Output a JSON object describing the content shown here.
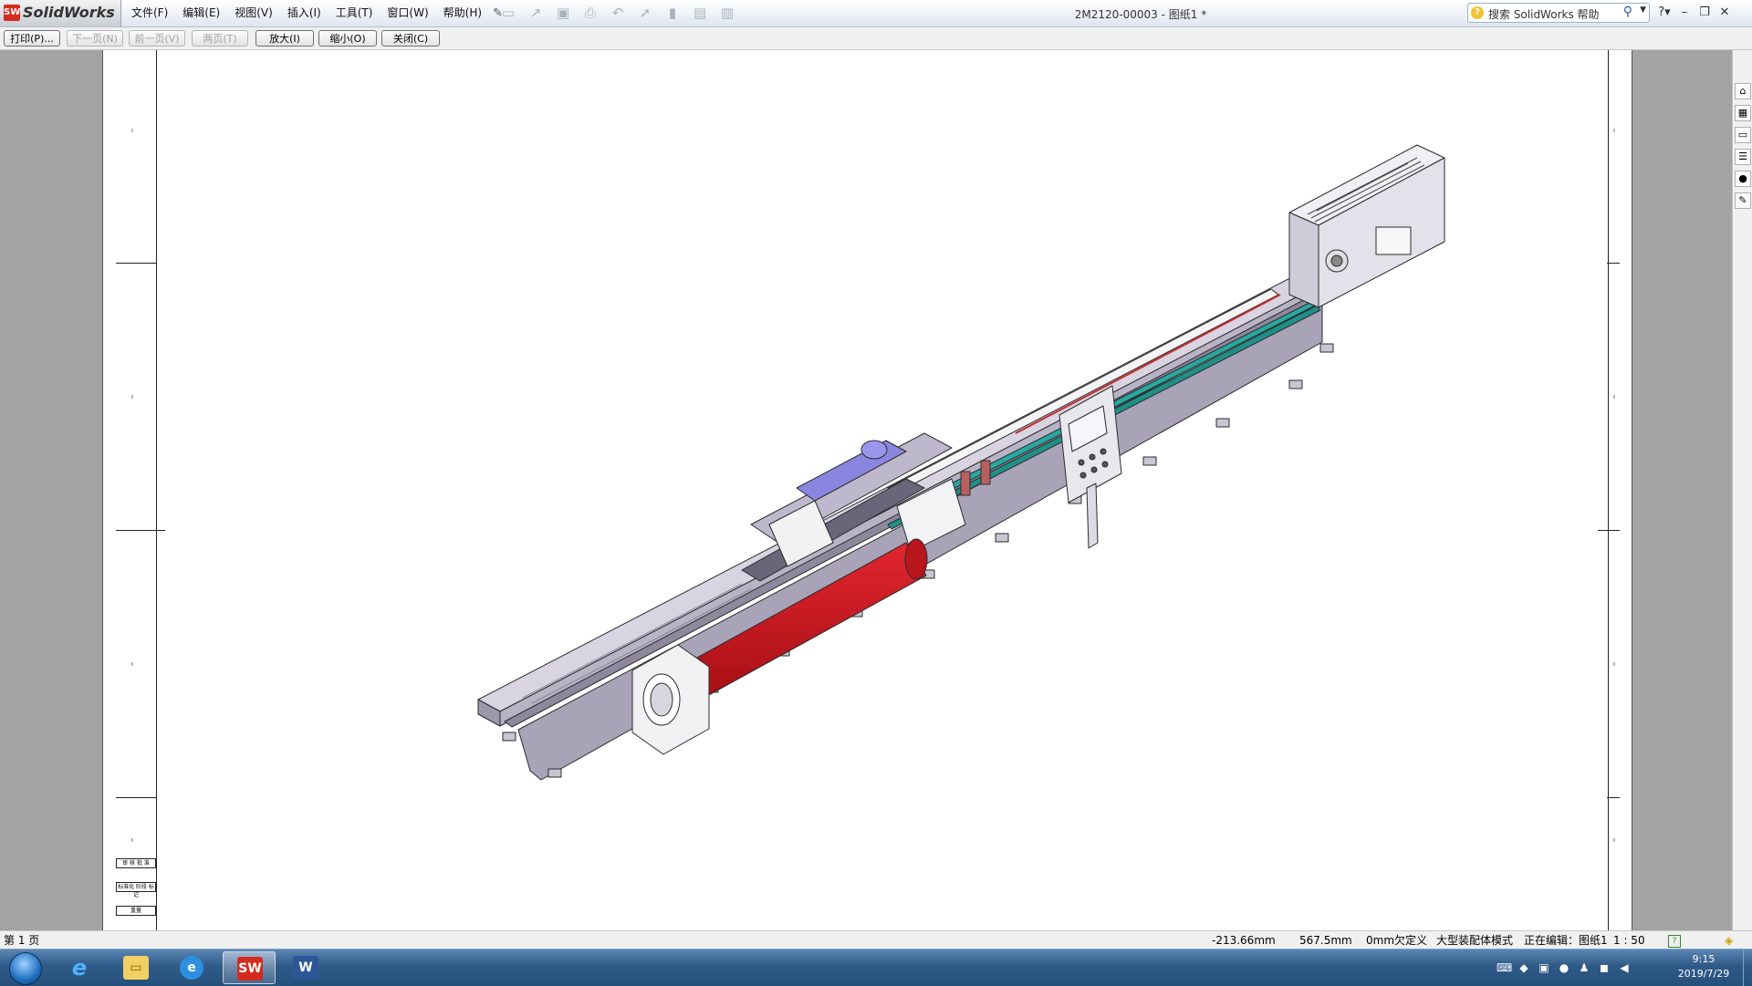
{
  "app": {
    "name": "SolidWorks",
    "doc_title": "2M2120-00003 - 图纸1 *"
  },
  "menu": [
    "文件(F)",
    "编辑(E)",
    "视图(V)",
    "插入(I)",
    "工具(T)",
    "窗口(W)",
    "帮助(H)"
  ],
  "help_search": {
    "placeholder": "搜索 SolidWorks 帮助"
  },
  "preview_toolbar": {
    "print": "打印(P)...",
    "next_page": "下一页(N)",
    "prev_page": "前一页(V)",
    "two_pages": "两页(T)",
    "zoom_in": "放大(I)",
    "zoom_out": "缩小(O)",
    "close": "关闭(C)"
  },
  "sheet": {
    "title_block_cells": [
      "审 核 批 准",
      "标准化 阶段 标记",
      "重量"
    ]
  },
  "status": {
    "page": "第 1 页",
    "x": "-213.66mm",
    "y": "567.5mm",
    "z": "0mm",
    "define": "欠定义",
    "mode": "大型装配体模式",
    "editing": "正在编辑：图纸1",
    "scale": "1 : 50"
  },
  "taskbar": {
    "time": "9:15",
    "date": "2019/7/29",
    "apps": [
      "start-orb-icon",
      "ie-icon",
      "explorer-icon",
      "ie-icon",
      "solidworks-icon",
      "word-icon"
    ]
  },
  "colors": {
    "workpiece": "#c8121b",
    "bed": "#b9b3c6",
    "guard": "#8a86e0",
    "rail": "#28a8a0",
    "titlebar": "#dfe6f0"
  }
}
